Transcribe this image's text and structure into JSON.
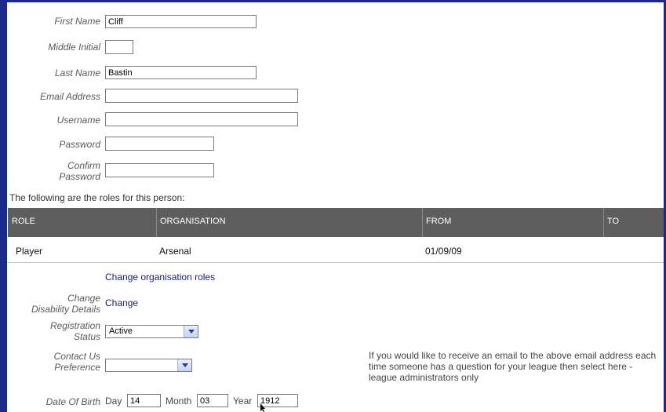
{
  "form": {
    "first_name_label": "First Name",
    "first_name_value": "Cliff",
    "middle_initial_label": "Middle Initial",
    "middle_initial_value": "",
    "last_name_label": "Last Name",
    "last_name_value": "Bastin",
    "email_label": "Email Address",
    "email_value": "",
    "username_label": "Username",
    "username_value": "",
    "password_label": "Password",
    "password_value": "",
    "confirm_label_line1": "Confirm",
    "confirm_label_line2": "Password",
    "confirm_value": ""
  },
  "roles": {
    "intro": "The following are the roles for this person:",
    "headers": {
      "role": "ROLE",
      "organisation": "ORGANISATION",
      "from": "FROM",
      "to": "TO"
    },
    "rows": [
      {
        "role": "Player",
        "organisation": "Arsenal",
        "from": "01/09/09",
        "to": ""
      }
    ],
    "change_link": "Change organisation roles"
  },
  "details": {
    "disability_label_line1": "Change",
    "disability_label_line2": "Disability Details",
    "disability_link": "Change",
    "registration_label_line1": "Registration",
    "registration_label_line2": "Status",
    "registration_value": "Active",
    "contact_label_line1": "Contact Us",
    "contact_label_line2": "Preference",
    "contact_value": "",
    "contact_note": "If you would like to receive an email to the above email address each time someone has a question for your league then select here - league administrators only"
  },
  "dob": {
    "label": "Date Of Birth",
    "day_label": "Day",
    "day_value": "14",
    "month_label": "Month",
    "month_value": "03",
    "year_label": "Year",
    "year_value": "1912"
  },
  "colors": {
    "frame": "#1a2a8c",
    "table_header": "#5e5e5e",
    "link": "#1a1a7a"
  }
}
